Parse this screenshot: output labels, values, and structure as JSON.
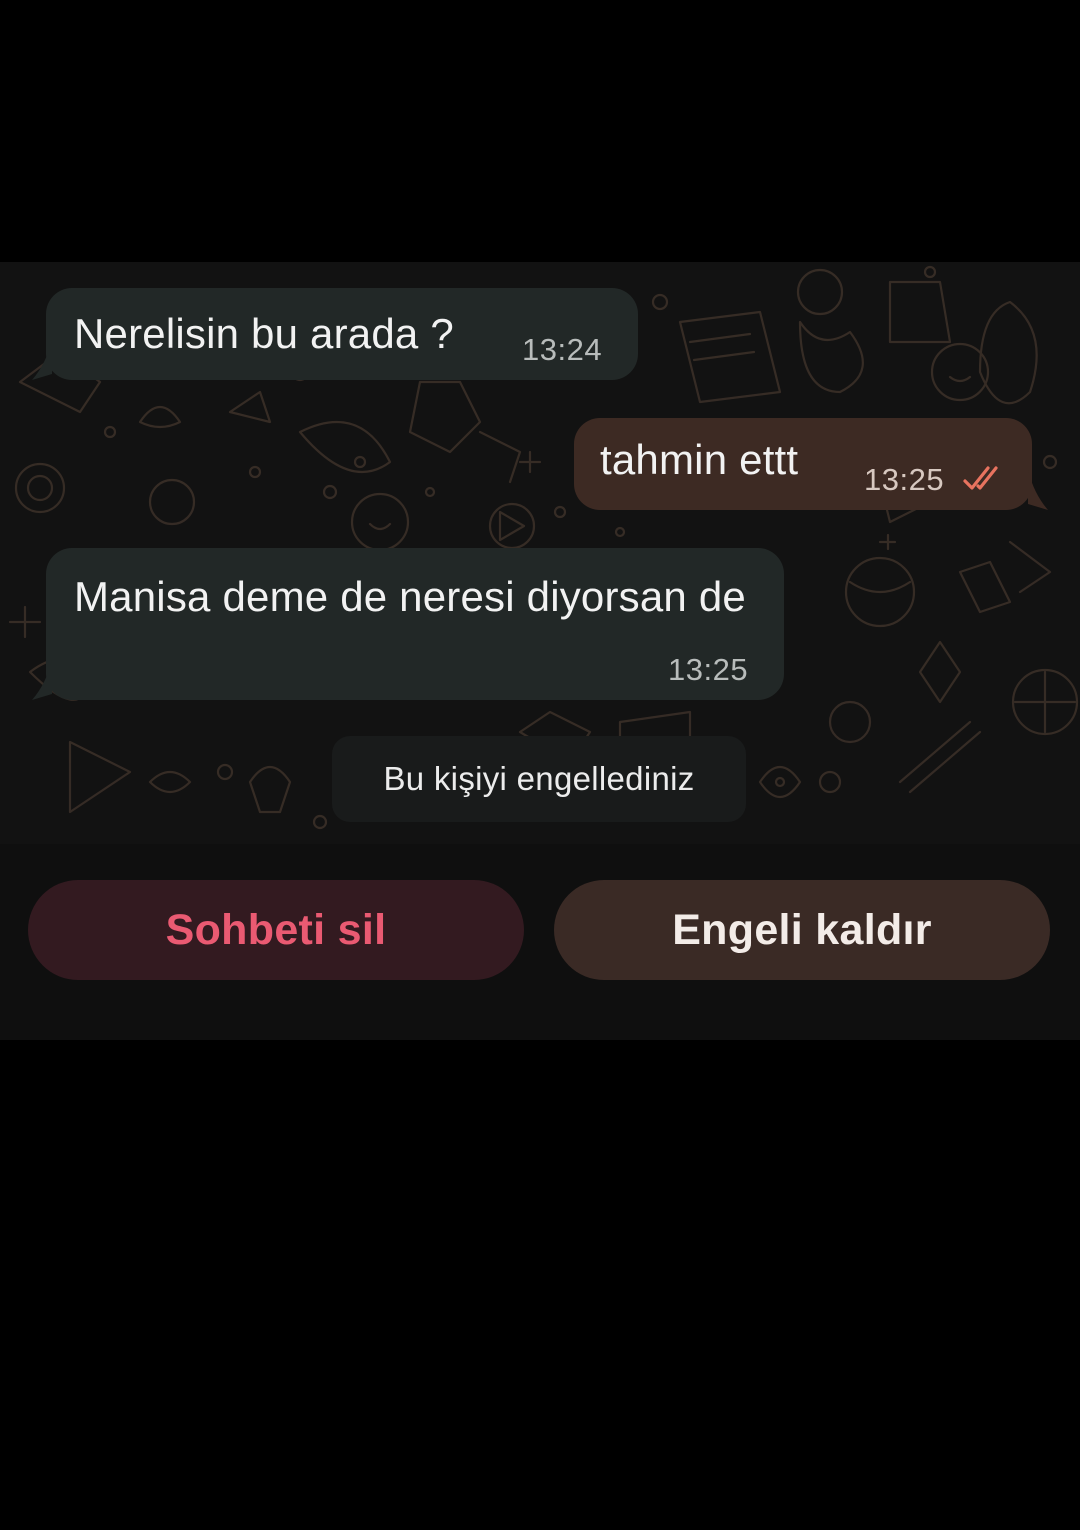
{
  "messages": [
    {
      "direction": "incoming",
      "text": "Nerelisin bu arada ?",
      "time": "13:24"
    },
    {
      "direction": "outgoing",
      "text": "tahmin ettt",
      "time": "13:25",
      "status_icon": "double-check-icon"
    },
    {
      "direction": "incoming",
      "text": "Manisa deme de neresi diyorsan de",
      "time": "13:25"
    }
  ],
  "system_note": "Bu kişiyi engellediniz",
  "actions": {
    "delete_chat_label": "Sohbeti sil",
    "unblock_label": "Engeli kaldır"
  },
  "colors": {
    "incoming_bubble": "#222827",
    "outgoing_bubble": "#3d2a23",
    "delete_text": "#ea5a72",
    "read_check": "#e8735f"
  }
}
